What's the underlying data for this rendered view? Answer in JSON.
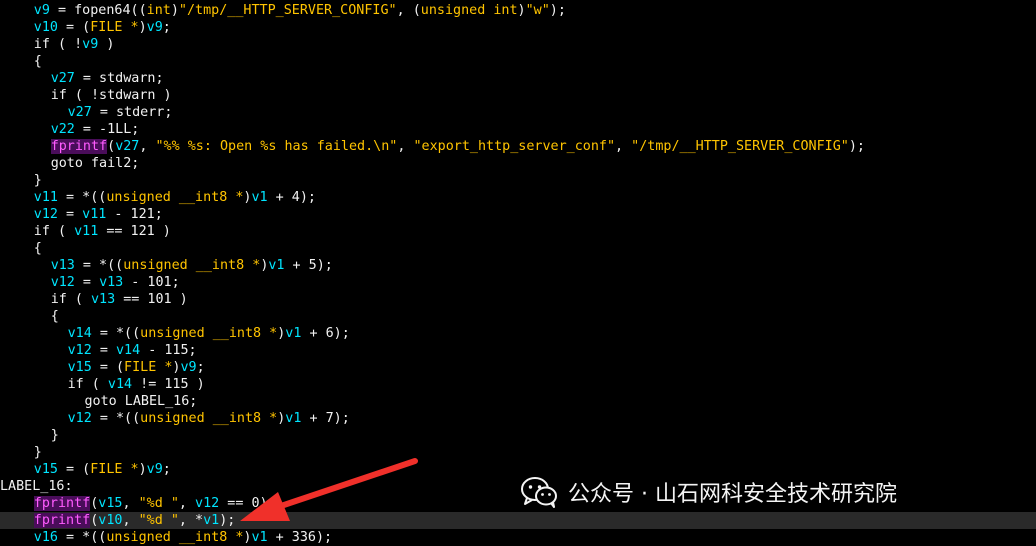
{
  "code_lines": [
    {
      "indent": 4,
      "tokens": [
        [
          "var",
          "v9"
        ],
        [
          "txt",
          " = fopen64(("
        ],
        [
          "kw",
          "int"
        ],
        [
          "txt",
          ")"
        ],
        [
          "str",
          "\"/tmp/__HTTP_SERVER_CONFIG\""
        ],
        [
          "txt",
          ", ("
        ],
        [
          "kw",
          "unsigned int"
        ],
        [
          "txt",
          ")"
        ],
        [
          "str",
          "\"w\""
        ],
        [
          "txt",
          ");"
        ]
      ]
    },
    {
      "indent": 4,
      "tokens": [
        [
          "var",
          "v10"
        ],
        [
          "txt",
          " = ("
        ],
        [
          "kw",
          "FILE *"
        ],
        [
          "txt",
          ")"
        ],
        [
          "var",
          "v9"
        ],
        [
          "txt",
          ";"
        ]
      ]
    },
    {
      "indent": 4,
      "tokens": [
        [
          "txt",
          "if ( !"
        ],
        [
          "var",
          "v9"
        ],
        [
          "txt",
          " )"
        ]
      ]
    },
    {
      "indent": 4,
      "tokens": [
        [
          "txt",
          "{"
        ]
      ]
    },
    {
      "indent": 6,
      "tokens": [
        [
          "var",
          "v27"
        ],
        [
          "txt",
          " = stdwarn;"
        ]
      ]
    },
    {
      "indent": 6,
      "tokens": [
        [
          "txt",
          "if ( !stdwarn )"
        ]
      ]
    },
    {
      "indent": 8,
      "tokens": [
        [
          "var",
          "v27"
        ],
        [
          "txt",
          " = stderr;"
        ]
      ]
    },
    {
      "indent": 6,
      "tokens": [
        [
          "var",
          "v22"
        ],
        [
          "txt",
          " = -1LL;"
        ]
      ]
    },
    {
      "indent": 6,
      "tokens": [
        [
          "fn",
          "fprintf"
        ],
        [
          "txt",
          "("
        ],
        [
          "var",
          "v27"
        ],
        [
          "txt",
          ", "
        ],
        [
          "str",
          "\"%% %s: Open %s has failed.\\n\""
        ],
        [
          "txt",
          ", "
        ],
        [
          "str",
          "\"export_http_server_conf\""
        ],
        [
          "txt",
          ", "
        ],
        [
          "str",
          "\"/tmp/__HTTP_SERVER_CONFIG\""
        ],
        [
          "txt",
          ");"
        ]
      ]
    },
    {
      "indent": 6,
      "tokens": [
        [
          "txt",
          "goto fail2;"
        ]
      ]
    },
    {
      "indent": 4,
      "tokens": [
        [
          "txt",
          "}"
        ]
      ]
    },
    {
      "indent": 4,
      "tokens": [
        [
          "var",
          "v11"
        ],
        [
          "txt",
          " = *(("
        ],
        [
          "kw",
          "unsigned __int8 *"
        ],
        [
          "txt",
          ")"
        ],
        [
          "var",
          "v1"
        ],
        [
          "txt",
          " + 4);"
        ]
      ]
    },
    {
      "indent": 4,
      "tokens": [
        [
          "var",
          "v12"
        ],
        [
          "txt",
          " = "
        ],
        [
          "var",
          "v11"
        ],
        [
          "txt",
          " - 121;"
        ]
      ]
    },
    {
      "indent": 4,
      "tokens": [
        [
          "txt",
          "if ( "
        ],
        [
          "var",
          "v11"
        ],
        [
          "txt",
          " == 121 )"
        ]
      ]
    },
    {
      "indent": 4,
      "tokens": [
        [
          "txt",
          "{"
        ]
      ]
    },
    {
      "indent": 6,
      "tokens": [
        [
          "var",
          "v13"
        ],
        [
          "txt",
          " = *(("
        ],
        [
          "kw",
          "unsigned __int8 *"
        ],
        [
          "txt",
          ")"
        ],
        [
          "var",
          "v1"
        ],
        [
          "txt",
          " + 5);"
        ]
      ]
    },
    {
      "indent": 6,
      "tokens": [
        [
          "var",
          "v12"
        ],
        [
          "txt",
          " = "
        ],
        [
          "var",
          "v13"
        ],
        [
          "txt",
          " - 101;"
        ]
      ]
    },
    {
      "indent": 6,
      "tokens": [
        [
          "txt",
          "if ( "
        ],
        [
          "var",
          "v13"
        ],
        [
          "txt",
          " == 101 )"
        ]
      ]
    },
    {
      "indent": 6,
      "tokens": [
        [
          "txt",
          "{"
        ]
      ]
    },
    {
      "indent": 8,
      "tokens": [
        [
          "var",
          "v14"
        ],
        [
          "txt",
          " = *(("
        ],
        [
          "kw",
          "unsigned __int8 *"
        ],
        [
          "txt",
          ")"
        ],
        [
          "var",
          "v1"
        ],
        [
          "txt",
          " + 6);"
        ]
      ]
    },
    {
      "indent": 8,
      "tokens": [
        [
          "var",
          "v12"
        ],
        [
          "txt",
          " = "
        ],
        [
          "var",
          "v14"
        ],
        [
          "txt",
          " - 115;"
        ]
      ]
    },
    {
      "indent": 8,
      "tokens": [
        [
          "var",
          "v15"
        ],
        [
          "txt",
          " = ("
        ],
        [
          "kw",
          "FILE *"
        ],
        [
          "txt",
          ")"
        ],
        [
          "var",
          "v9"
        ],
        [
          "txt",
          ";"
        ]
      ]
    },
    {
      "indent": 8,
      "tokens": [
        [
          "txt",
          "if ( "
        ],
        [
          "var",
          "v14"
        ],
        [
          "txt",
          " != 115 )"
        ]
      ]
    },
    {
      "indent": 10,
      "tokens": [
        [
          "txt",
          "goto LABEL_16;"
        ]
      ]
    },
    {
      "indent": 8,
      "tokens": [
        [
          "var",
          "v12"
        ],
        [
          "txt",
          " = *(("
        ],
        [
          "kw",
          "unsigned __int8 *"
        ],
        [
          "txt",
          ")"
        ],
        [
          "var",
          "v1"
        ],
        [
          "txt",
          " + 7);"
        ]
      ]
    },
    {
      "indent": 6,
      "tokens": [
        [
          "txt",
          "}"
        ]
      ]
    },
    {
      "indent": 4,
      "tokens": [
        [
          "txt",
          "}"
        ]
      ]
    },
    {
      "indent": 4,
      "tokens": [
        [
          "var",
          "v15"
        ],
        [
          "txt",
          " = ("
        ],
        [
          "kw",
          "FILE *"
        ],
        [
          "txt",
          ")"
        ],
        [
          "var",
          "v9"
        ],
        [
          "txt",
          ";"
        ]
      ]
    },
    {
      "indent": 0,
      "tokens": [
        [
          "lbl",
          "LABEL_16:"
        ]
      ]
    },
    {
      "indent": 4,
      "tokens": [
        [
          "fn",
          "fprintf"
        ],
        [
          "txt",
          "("
        ],
        [
          "var",
          "v15"
        ],
        [
          "txt",
          ", "
        ],
        [
          "str",
          "\"%d \""
        ],
        [
          "txt",
          ", "
        ],
        [
          "var",
          "v12"
        ],
        [
          "txt",
          " == 0);"
        ]
      ]
    },
    {
      "indent": 4,
      "current": true,
      "tokens": [
        [
          "fn",
          "fprintf"
        ],
        [
          "txt",
          "("
        ],
        [
          "var",
          "v10"
        ],
        [
          "txt",
          ", "
        ],
        [
          "str",
          "\"%d \""
        ],
        [
          "txt",
          ", *"
        ],
        [
          "var",
          "v1"
        ],
        [
          "txt",
          ");"
        ]
      ]
    },
    {
      "indent": 4,
      "tokens": [
        [
          "var",
          "v16"
        ],
        [
          "txt",
          " = *(("
        ],
        [
          "kw",
          "unsigned __int8 *"
        ],
        [
          "txt",
          ")"
        ],
        [
          "var",
          "v1"
        ],
        [
          "txt",
          " + 336);"
        ]
      ]
    }
  ],
  "watermark": {
    "logo_icon": "wechat-icon",
    "text": "公众号 · 山石网科安全技术研究院"
  },
  "annotation": {
    "arrow_icon": "red-arrow-icon",
    "color": "#f0302a"
  },
  "colors": {
    "background": "#000000",
    "identifier": "#00e5ff",
    "keyword_and_string": "#ffc400",
    "function_highlight_text": "#ff5cff",
    "function_highlight_bg": "#4a0d5a",
    "plain_text": "#f2f2f2"
  }
}
